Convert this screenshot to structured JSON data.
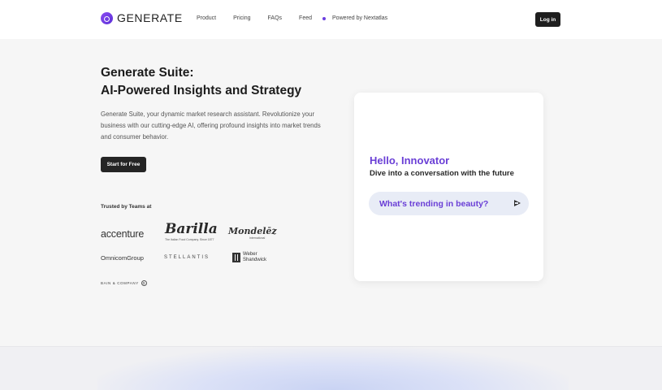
{
  "header": {
    "brand": "GENERATE",
    "nav": [
      {
        "label": "Product"
      },
      {
        "label": "Pricing"
      },
      {
        "label": "FAQs"
      },
      {
        "label": "Feed"
      },
      {
        "label": "Powered by Nextatlas"
      }
    ],
    "login_label": "Log in"
  },
  "hero": {
    "title_line1": "Generate Suite:",
    "title_line2": "AI-Powered Insights and Strategy",
    "description": "Generate Suite, your dynamic market research assistant. Revolutionize your business with our cutting-edge AI, offering profound insights into market trends and consumer behavior.",
    "cta_label": "Start for Free",
    "trusted_label": "Trusted by Teams at",
    "logos": {
      "accenture": "accenture",
      "barilla": "Barilla",
      "barilla_sub": "The Italian Food Company. Since 1877",
      "mondelez": "Mondelēz",
      "mondelez_sub": "International",
      "omnicom": "OmnicomGroup",
      "stellantis": "STELLANTIS",
      "weber_line1": "Weber",
      "weber_line2": "Shandwick",
      "bain": "BAIN & COMPANY"
    }
  },
  "chat_card": {
    "greeting": "Hello, Innovator",
    "subgreeting": "Dive into a conversation with the future",
    "prompt": "What's trending in beauty?"
  },
  "colors": {
    "accent": "#6a3fd6",
    "dark_button": "#1e1e1e",
    "prompt_bg": "#e8ecf6"
  },
  "icons": {
    "brand": "generate-logo-icon",
    "send": "send-arrow-icon",
    "nav_separator": "dot-icon"
  }
}
